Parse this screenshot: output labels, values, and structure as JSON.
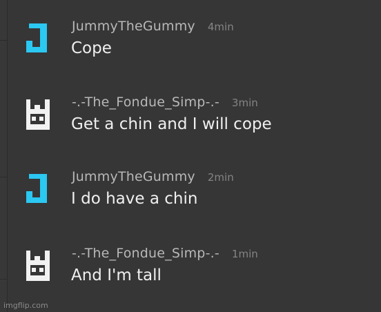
{
  "messages": [
    {
      "username": "JummyTheGummy",
      "timestamp": "4min",
      "text": "Cope",
      "avatar_icon": "letter-j-icon",
      "avatar_color": "#2bc8f2"
    },
    {
      "username": "-.-The_Fondue_Simp-.-",
      "timestamp": "3min",
      "text": "Get a chin and I will cope",
      "avatar_icon": "cat-face-icon",
      "avatar_color": "#f2f2f2"
    },
    {
      "username": "JummyTheGummy",
      "timestamp": "2min",
      "text": "I do have a chin",
      "avatar_icon": "letter-j-icon",
      "avatar_color": "#2bc8f2"
    },
    {
      "username": "-.-The_Fondue_Simp-.-",
      "timestamp": "1min",
      "text": "And I'm tall",
      "avatar_icon": "cat-face-icon",
      "avatar_color": "#f2f2f2"
    }
  ],
  "watermark": "imgflip.com",
  "colors": {
    "background": "#363636",
    "username": "#b8b8b8",
    "timestamp": "#858585",
    "message_text": "#f0f0f0"
  }
}
